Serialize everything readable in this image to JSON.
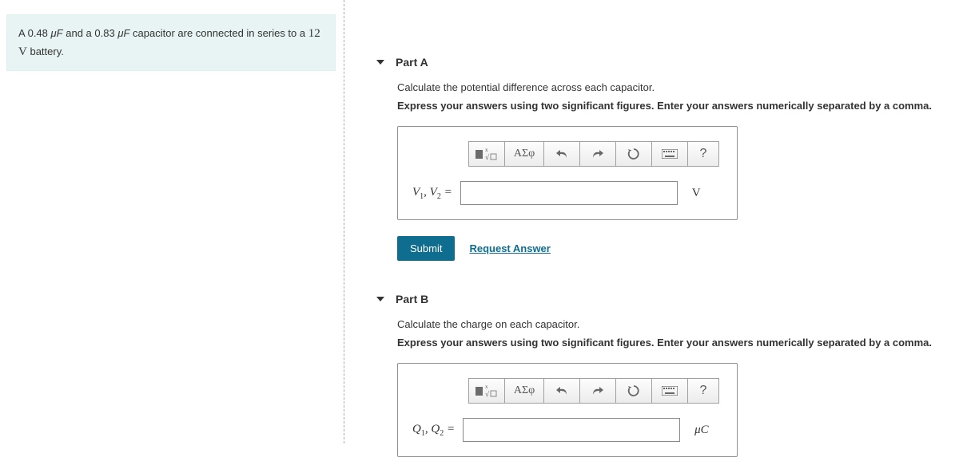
{
  "question": {
    "c1": "0.48",
    "c2": "0.83",
    "unit": "μF",
    "volt": "12",
    "voltUnit": "V",
    "prefix": "A",
    "mid1": "and a",
    "mid2": "capacitor are connected in series to a",
    "suffix": "battery."
  },
  "parts": [
    {
      "title": "Part A",
      "prompt": "Calculate the potential difference across each capacitor.",
      "instruction": "Express your answers using two significant figures. Enter your answers numerically separated by a comma.",
      "varLabel": {
        "v1": "V",
        "s1": "1",
        "comma": ", ",
        "v2": "V",
        "s2": "2",
        "eq": " ="
      },
      "unit": "V",
      "value": "",
      "submit": "Submit",
      "request": "Request Answer",
      "toolbar": {
        "greek": "ΑΣφ",
        "help": "?"
      }
    },
    {
      "title": "Part B",
      "prompt": "Calculate the charge on each capacitor.",
      "instruction": "Express your answers using two significant figures. Enter your answers numerically separated by a comma.",
      "varLabel": {
        "v1": "Q",
        "s1": "1",
        "comma": ", ",
        "v2": "Q",
        "s2": "2",
        "eq": " ="
      },
      "unit": "μC",
      "value": "",
      "toolbar": {
        "greek": "ΑΣφ",
        "help": "?"
      }
    }
  ]
}
